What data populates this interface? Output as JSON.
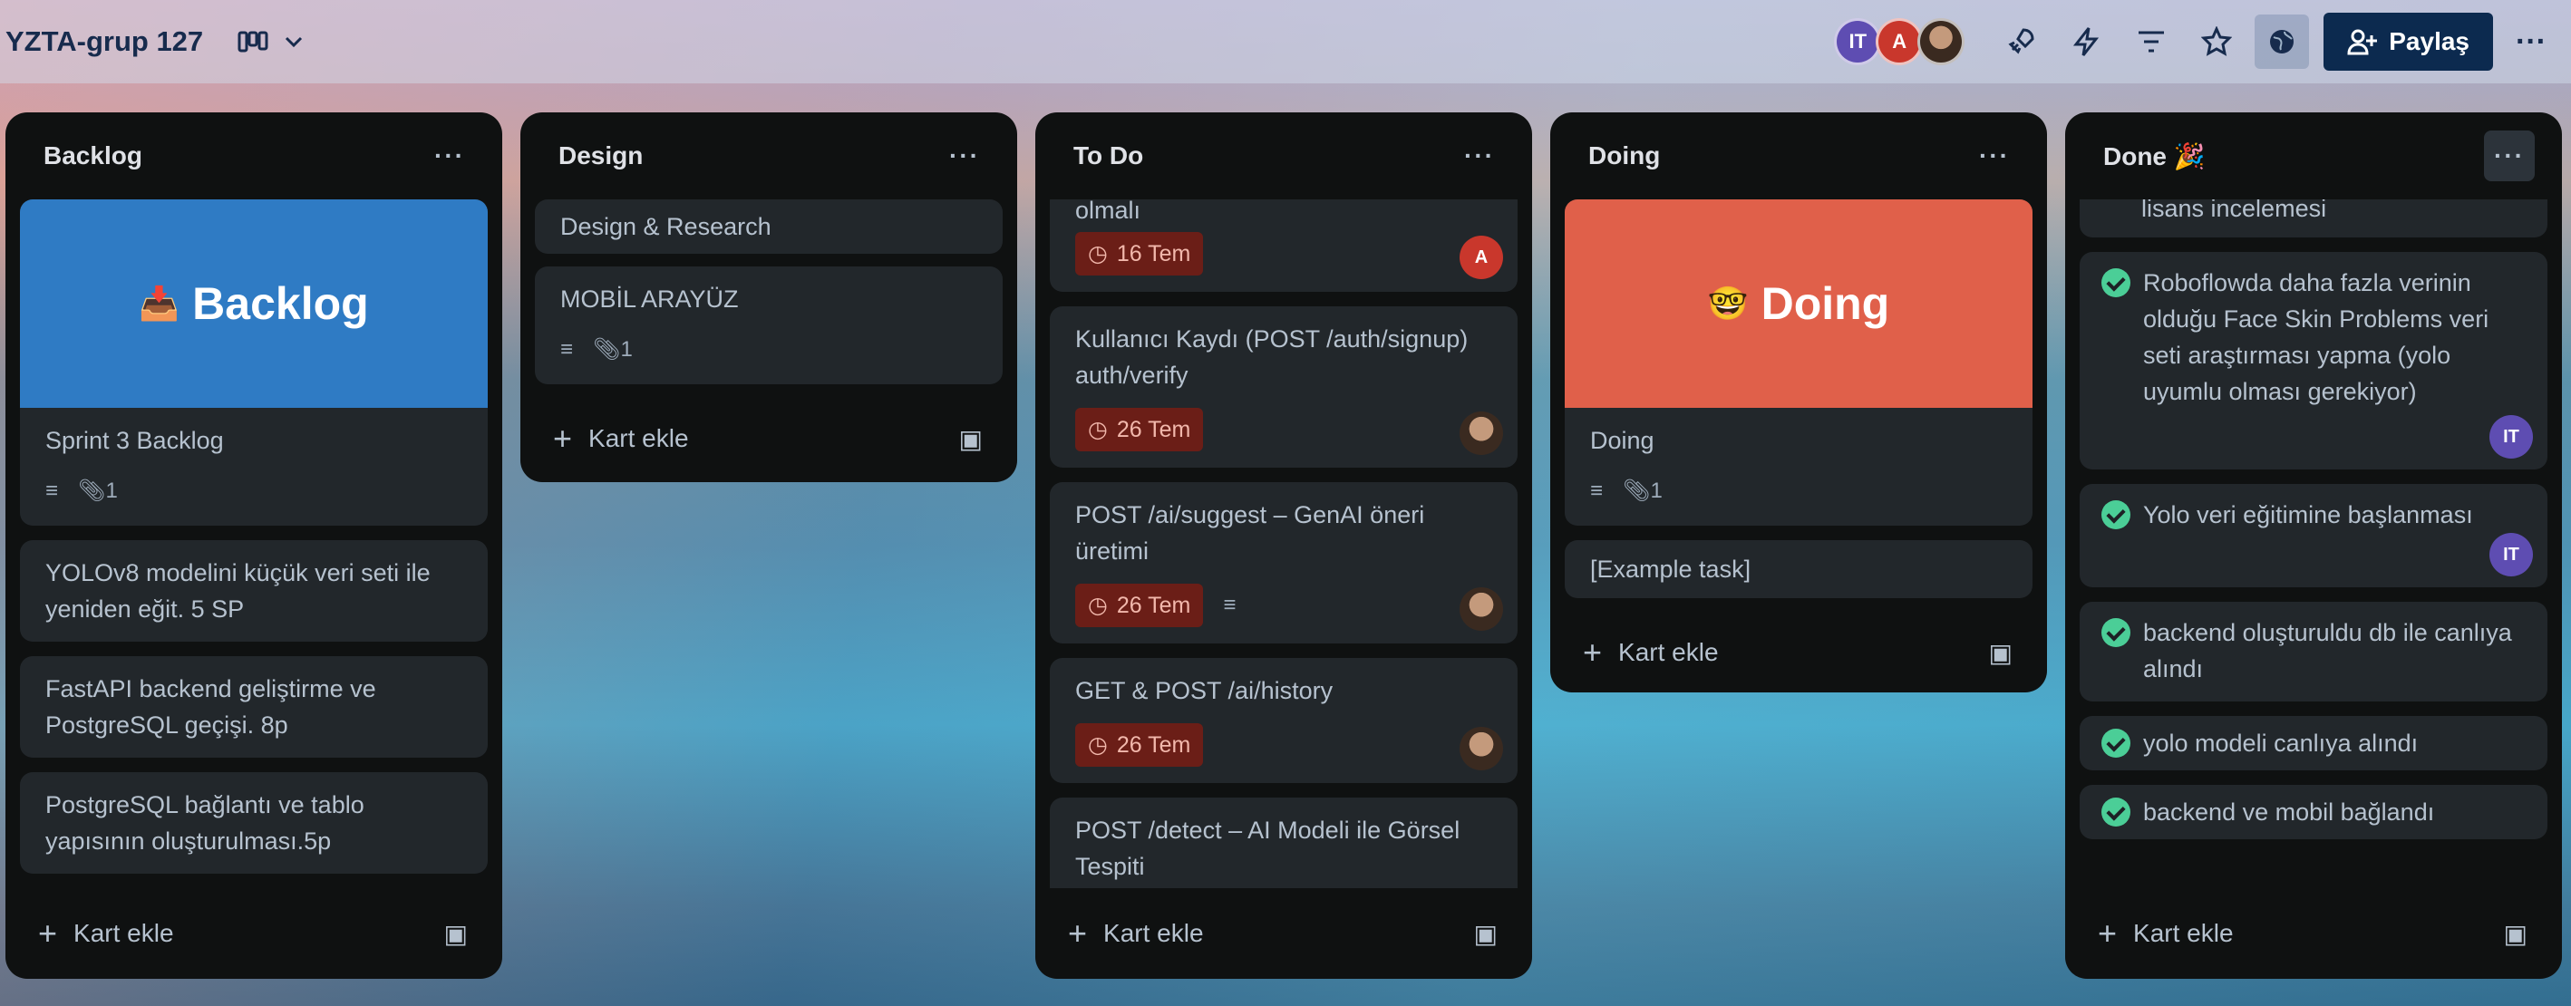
{
  "board": {
    "title": "YZTA-grup 127"
  },
  "header": {
    "share_label": "Paylaş",
    "members": [
      {
        "initials": "IT",
        "color": "#5e4db2"
      },
      {
        "initials": "A",
        "color": "#c9372c"
      },
      {
        "initials": "",
        "color": "#8a6a50"
      }
    ]
  },
  "lists": [
    {
      "title": "Backlog",
      "add_label": "Kart ekle",
      "cover": {
        "label": "Backlog",
        "emoji": "📥",
        "color": "#2f7bc4"
      },
      "cards": [
        {
          "title": "Sprint 3 Backlog",
          "attachments": "1"
        },
        {
          "title": "YOLOv8 modelini küçük veri seti ile yeniden eğit. 5 SP"
        },
        {
          "title": "FastAPI backend geliştirme ve PostgreSQL geçişi. 8p"
        },
        {
          "title": "PostgreSQL bağlantı ve tablo yapısının oluşturulması.5p"
        }
      ]
    },
    {
      "title": "Design",
      "add_label": "Kart ekle",
      "cards": [
        {
          "title": "Design & Research"
        },
        {
          "title": "MOBİL ARAYÜZ",
          "attachments": "1"
        }
      ]
    },
    {
      "title": "To Do",
      "add_label": "Kart ekle",
      "cards": [
        {
          "title": "olmalı",
          "due": "16 Tem",
          "member": "A"
        },
        {
          "title": "Kullanıcı Kaydı (POST /auth/signup) auth/verify",
          "due": "26 Tem"
        },
        {
          "title": "POST /ai/suggest – GenAI öneri üretimi",
          "due": "26 Tem"
        },
        {
          "title": "GET & POST /ai/history",
          "due": "26 Tem"
        },
        {
          "title": "POST /detect – AI Modeli ile Görsel Tespiti"
        }
      ]
    },
    {
      "title": "Doing",
      "add_label": "Kart ekle",
      "cover": {
        "label": "Doing",
        "emoji": "🤓",
        "color": "#e0604a"
      },
      "cards": [
        {
          "title": "Doing",
          "attachments": "1"
        },
        {
          "title": "[Example task]"
        }
      ]
    },
    {
      "title": "Done 🎉",
      "add_label": "Kart ekle",
      "cards": [
        {
          "title": "lisans incelemesi"
        },
        {
          "title": "Roboflowda daha fazla verinin olduğu Face Skin Problems veri seti araştırması yapma (yolo uyumlu olması gerekiyor)",
          "member": "IT"
        },
        {
          "title": "Yolo veri eğitimine başlanması",
          "member": "IT"
        },
        {
          "title": "backend oluşturuldu db ile canlıya alındı"
        },
        {
          "title": "yolo modeli canlıya alındı"
        },
        {
          "title": "backend ve mobil bağlandı"
        }
      ]
    }
  ]
}
